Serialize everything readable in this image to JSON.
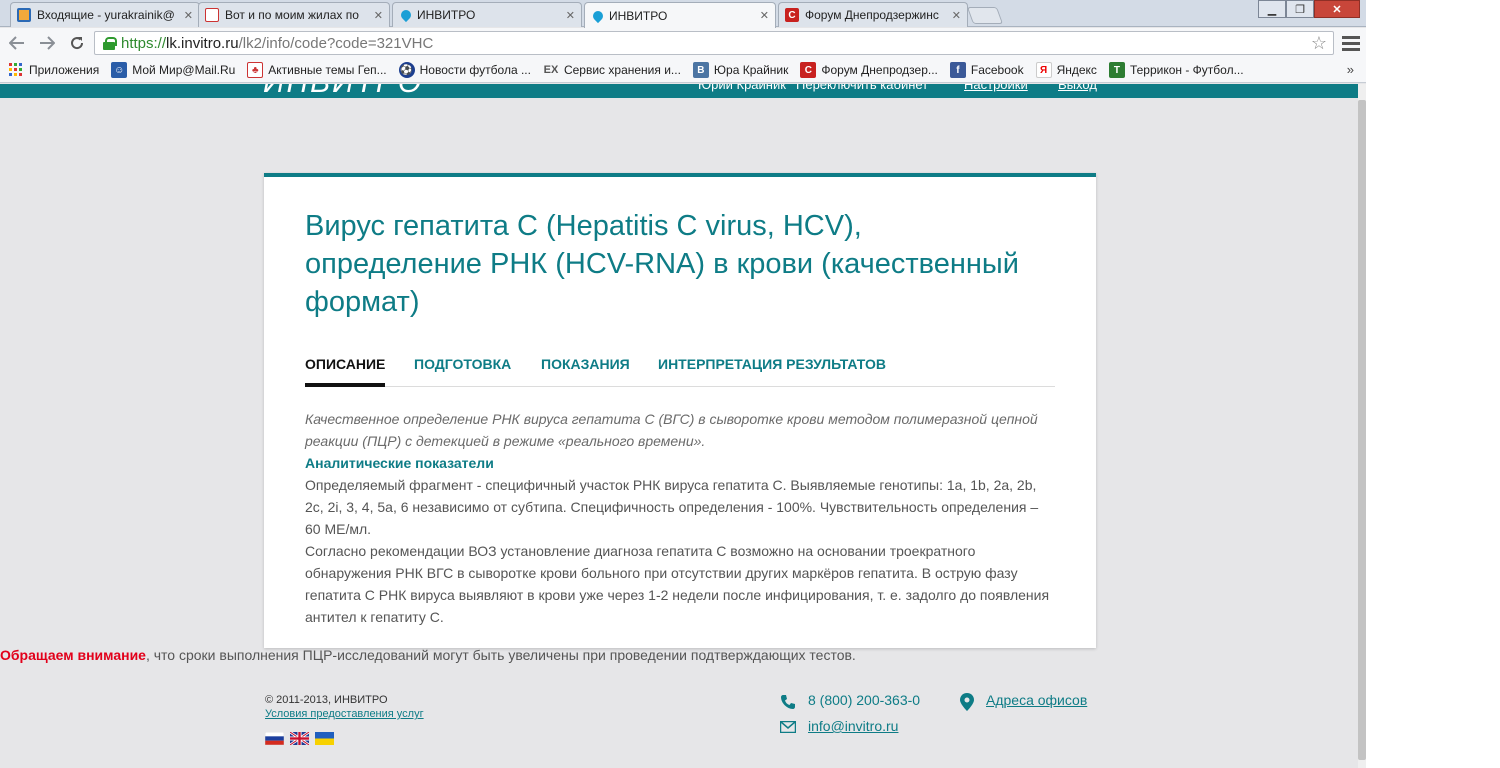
{
  "browser": {
    "tabs": [
      {
        "title": "Входящие - yurakrainik@",
        "favicon": "mail-ru-icon",
        "active": false
      },
      {
        "title": "Вот и по моим жилах по",
        "favicon": "forum-icon",
        "active": false
      },
      {
        "title": "ИНВИТРО",
        "favicon": "invitro-drop-icon",
        "active": false
      },
      {
        "title": "ИНВИТРО",
        "favicon": "invitro-drop-icon",
        "active": true
      },
      {
        "title": "Форум Днепродзержинс",
        "favicon": "forum-s-icon",
        "active": false
      }
    ],
    "url": {
      "scheme": "https://",
      "host": "lk.invitro.ru",
      "path": "/lk2/info/code?code=321VHC"
    },
    "bookmarks": [
      {
        "label": "Приложения",
        "icon": "apps-grid-icon"
      },
      {
        "label": "Мой Мир@Mail.Ru",
        "icon": "moi-mir-icon"
      },
      {
        "label": "Активные темы Геп...",
        "icon": "forum-icon"
      },
      {
        "label": "Новости футбола ...",
        "icon": "football-icon"
      },
      {
        "label": "Сервис хранения и...",
        "icon": "ex-icon"
      },
      {
        "label": "Юра Крайник",
        "icon": "vk-icon"
      },
      {
        "label": "Форум Днепродзер...",
        "icon": "forum-s-icon"
      },
      {
        "label": "Facebook",
        "icon": "facebook-icon"
      },
      {
        "label": "Яндекс",
        "icon": "yandex-icon"
      },
      {
        "label": "Террикон - Футбол...",
        "icon": "terrikon-icon"
      }
    ],
    "bookmarks_more": "»"
  },
  "site_header": {
    "logo": "ИНВИТРО",
    "user_name": "Юрий Крайник",
    "switch_cabinet": "Переключить кабинет",
    "settings": "Настройки",
    "logout": "Выход"
  },
  "card": {
    "title": "Вирус гепатита С (Hepatitis C virus, HCV), определение РНК (HCV-RNA) в крови (качественный формат)",
    "tabs": [
      {
        "label": "ОПИСАНИЕ",
        "active": true
      },
      {
        "label": "ПОДГОТОВКА",
        "active": false
      },
      {
        "label": "ПОКАЗАНИЯ",
        "active": false
      },
      {
        "label": "ИНТЕРПРЕТАЦИЯ РЕЗУЛЬТАТОВ",
        "active": false
      }
    ],
    "description_italic": "Качественное определение РНК вируса гепатита С (ВГС) в сыворотке крови методом полимеразной цепной реакции (ПЦР) с детекцией в режиме «реального времени».",
    "analytics_heading": "Аналитические показатели",
    "analytics_text": "Определяемый фрагмент - специфичный участок РНК вируса гепатита С. Выявляемые генотипы: 1a, 1b, 2a, 2b, 2c, 2i, 3, 4, 5a, 6 независимо от субтипа. Специфичность определения - 100%. Чувствительность определения – 60 МЕ/мл.",
    "who_text": "Согласно рекомендации ВОЗ установление диагноза гепатита С возможно на основании троекратного обнаружения РНК ВГС в сыворотке крови больного при отсутствии других маркёров гепатита. В острую фазу гепатита С РНК вируса выявляют в крови уже через 1-2 недели после инфицирования, т. е. задолго до появления антител к гепатиту С."
  },
  "notice": {
    "strong": "Обращаем внимание",
    "text": ", что сроки выполнения ПЦР-исследований могут быть увеличены при проведении подтверждающих тестов."
  },
  "footer": {
    "copyright": "© 2011-2013, ИНВИТРО",
    "terms_link": "Условия предоставления услуг",
    "phone": "8 (800) 200-363-0",
    "email": "info@invitro.ru",
    "offices_link": "Адреса офисов",
    "flags": [
      "ru-flag",
      "uk-flag",
      "ua-flag"
    ]
  },
  "colors": {
    "brand": "#0e7c86",
    "notice_red": "#e2001a"
  }
}
